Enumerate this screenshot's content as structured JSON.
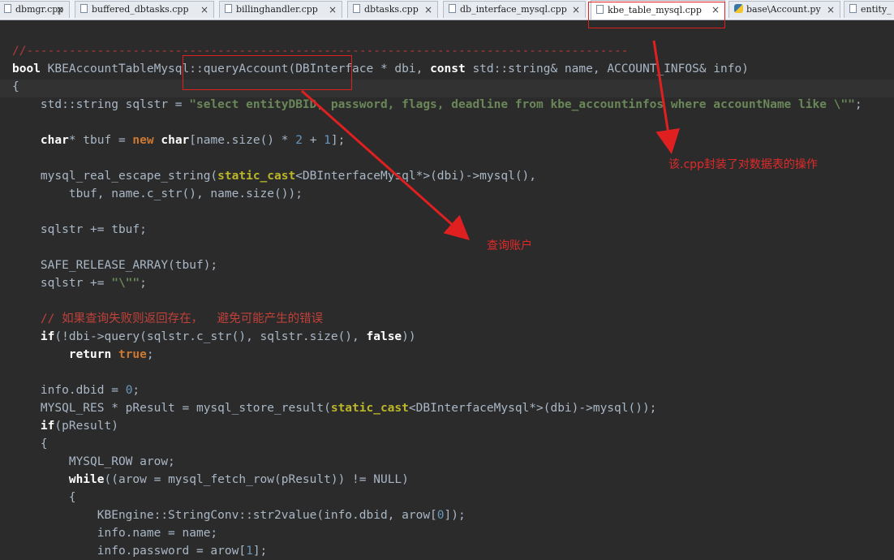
{
  "tabs": [
    {
      "label": "dbmgr.cpp",
      "icon": "file-icon",
      "active": false
    },
    {
      "label": "buffered_dbtasks.cpp",
      "icon": "file-icon",
      "active": false
    },
    {
      "label": "billinghandler.cpp",
      "icon": "file-icon",
      "active": false
    },
    {
      "label": "dbtasks.cpp",
      "icon": "file-icon",
      "active": false
    },
    {
      "label": "db_interface_mysql.cpp",
      "icon": "file-icon",
      "active": false
    },
    {
      "label": "kbe_table_mysql.cpp",
      "icon": "file-icon",
      "active": true
    },
    {
      "label": "base\\Account.py",
      "icon": "python-file-icon",
      "active": false
    },
    {
      "label": "entity_",
      "icon": "file-icon",
      "active": false
    }
  ],
  "tab_close_glyph": "×",
  "code": {
    "separator": "//-------------------------------------------------------------------------------------",
    "l1": {
      "bool": "bool",
      "cls": " KBEAccountTableMysql::queryAccount(DBInterface * dbi, ",
      "const": "const",
      "rest": " std::string& name, ACCOUNT_INFOS& info)"
    },
    "l2": "{",
    "l3": {
      "pre": "    std::string sqlstr = ",
      "str": "\"select entityDBID, password, flags, deadline from kbe_accountinfos where accountName like \\\"\"",
      "end": ";"
    },
    "l4": {
      "char1": "    char",
      "mid": "* tbuf = ",
      "new": "new",
      "sp": " ",
      "char2": "char",
      "a": "[name.size() * ",
      "n2": "2",
      "b": " + ",
      "n1": "1",
      "c": "];"
    },
    "l5": {
      "pre": "    mysql_real_escape_string(",
      "cast": "static_cast",
      "post": "<DBInterfaceMysql*>(dbi)->mysql(),"
    },
    "l6": "        tbuf, name.c_str(), name.size());",
    "l7": "    sqlstr += tbuf;",
    "l8": "    SAFE_RELEASE_ARRAY(tbuf);",
    "l9": {
      "pre": "    sqlstr += ",
      "str": "\"\\\"\"",
      "end": ";"
    },
    "l10": "    // 如果查询失败则返回存在，  避免可能产生的错误",
    "l11": {
      "ind": "    ",
      "if": "if",
      "pre": "(!dbi->query(sqlstr.c_str(), sqlstr.size(), ",
      "false": "false",
      "end": "))"
    },
    "l12": {
      "ind": "        ",
      "return": "return",
      "sp": " ",
      "true": "true",
      "end": ";"
    },
    "l13": {
      "pre": "    info.dbid = ",
      "num": "0",
      "end": ";"
    },
    "l14": {
      "pre": "    MYSQL_RES * pResult = mysql_store_result(",
      "cast": "static_cast",
      "post": "<DBInterfaceMysql*>(dbi)->mysql());"
    },
    "l15": {
      "ind": "    ",
      "if": "if",
      "post": "(pResult)"
    },
    "l16": "    {",
    "l17": "        MYSQL_ROW arow;",
    "l18": {
      "ind": "        ",
      "while": "while",
      "post": "((arow = mysql_fetch_row(pResult)) != NULL)"
    },
    "l19": "        {",
    "l20": {
      "pre": "            KBEngine::StringConv::str2value(info.dbid, arow[",
      "num": "0",
      "end": "]);"
    },
    "l21": "            info.name = name;",
    "l22": {
      "pre": "            info.password = arow[",
      "num": "1",
      "end": "];"
    }
  },
  "annotations": {
    "query_note": "查询账户",
    "cpp_note": "该.cpp封装了对数据表的操作"
  },
  "colors": {
    "background": "#2b2b2b",
    "keyword": "#ffffff",
    "string": "#6a8759",
    "number": "#6897bb",
    "cast": "#bbb529",
    "annotation_red": "#e02020"
  }
}
